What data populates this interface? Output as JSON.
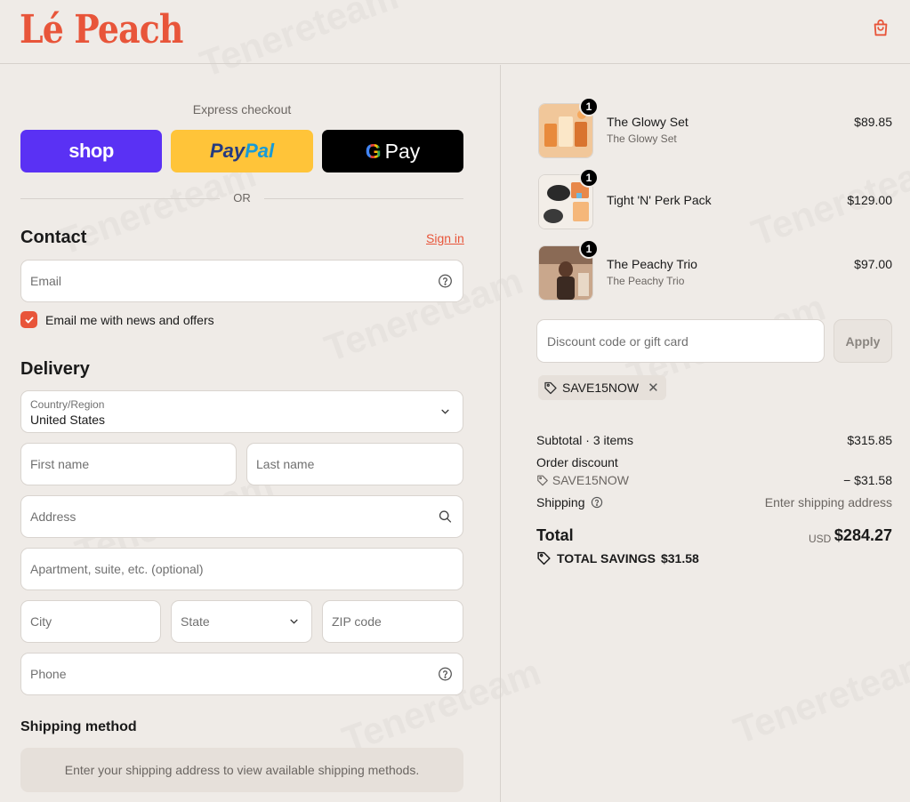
{
  "brand": {
    "logo_text": "Lé Peach",
    "accent_color": "#e8553a"
  },
  "header": {
    "cart_icon": "shopping-bag-icon"
  },
  "express": {
    "label": "Express checkout",
    "shop_label": "shop",
    "paypal_pay": "Pay",
    "paypal_pal": "Pal",
    "gpay_g": "G",
    "gpay_label": "Pay",
    "or_label": "OR"
  },
  "contact": {
    "title": "Contact",
    "sign_in": "Sign in",
    "email_placeholder": "Email",
    "newsletter_label": "Email me with news and offers",
    "newsletter_checked": true
  },
  "delivery": {
    "title": "Delivery",
    "country_label": "Country/Region",
    "country_value": "United States",
    "first_name_placeholder": "First name",
    "last_name_placeholder": "Last name",
    "address_placeholder": "Address",
    "apartment_placeholder": "Apartment, suite, etc. (optional)",
    "city_placeholder": "City",
    "state_placeholder": "State",
    "zip_placeholder": "ZIP code",
    "phone_placeholder": "Phone"
  },
  "shipping_method": {
    "title": "Shipping method",
    "notice": "Enter your shipping address to view available shipping methods."
  },
  "cart": {
    "items": [
      {
        "name": "The Glowy Set",
        "variant": "The Glowy Set",
        "price": "$89.85",
        "qty": "1"
      },
      {
        "name": "Tight 'N' Perk Pack",
        "variant": "",
        "price": "$129.00",
        "qty": "1"
      },
      {
        "name": "The Peachy Trio",
        "variant": "The Peachy Trio",
        "price": "$97.00",
        "qty": "1"
      }
    ],
    "discount_placeholder": "Discount code or gift card",
    "apply_label": "Apply",
    "applied_code": "SAVE15NOW"
  },
  "summary": {
    "subtotal_label": "Subtotal · 3 items",
    "subtotal_value": "$315.85",
    "order_discount_label": "Order discount",
    "discount_code": "SAVE15NOW",
    "discount_value": "− $31.58",
    "shipping_label": "Shipping",
    "shipping_value": "Enter shipping address",
    "total_label": "Total",
    "currency": "USD",
    "total_value": "$284.27",
    "savings_label": "TOTAL SAVINGS",
    "savings_value": "$31.58"
  }
}
